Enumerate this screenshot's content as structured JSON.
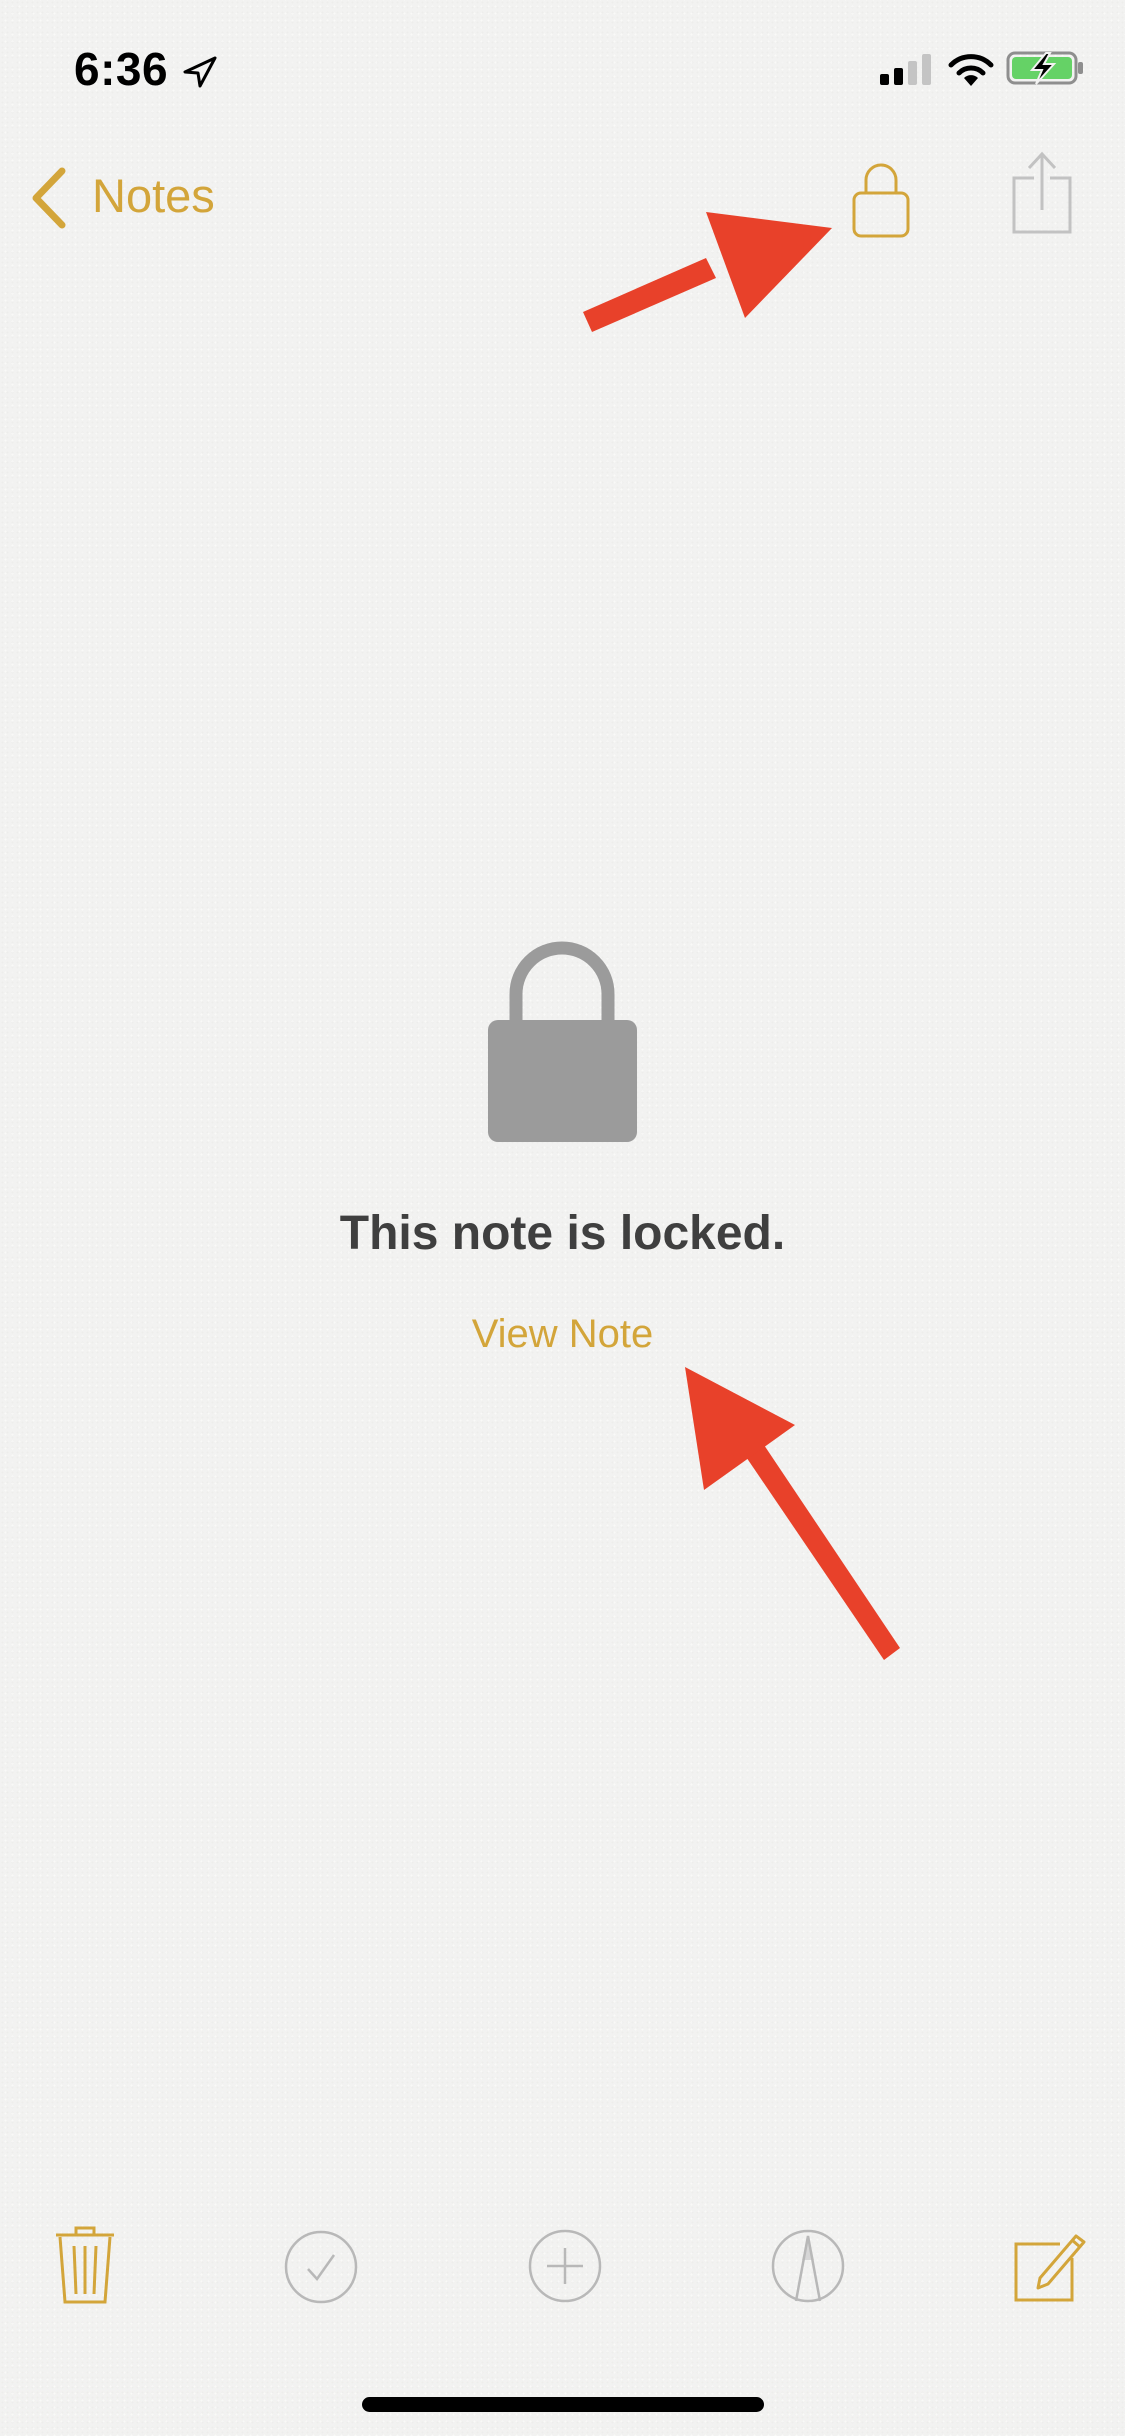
{
  "status_bar": {
    "time": "6:36",
    "location_icon": "location-arrow-icon",
    "signal_bars_active": 2,
    "signal_bars_total": 4,
    "wifi_icon": "wifi-icon",
    "battery_icon": "battery-charging-icon",
    "battery_level_fraction": 0.9,
    "charging": true
  },
  "nav_bar": {
    "back_label": "Notes",
    "back_icon": "chevron-left-icon",
    "lock_icon": "lock-icon",
    "share_icon": "share-icon"
  },
  "content": {
    "lock_icon": "lock-icon",
    "message": "This note is locked.",
    "view_note_label": "View Note"
  },
  "toolbar": {
    "items": [
      {
        "name": "delete",
        "icon": "trash-icon",
        "enabled": true
      },
      {
        "name": "checklist",
        "icon": "checkmark-circle-icon",
        "enabled": false
      },
      {
        "name": "add",
        "icon": "plus-circle-icon",
        "enabled": false
      },
      {
        "name": "sketch",
        "icon": "sketch-pen-icon",
        "enabled": false
      },
      {
        "name": "compose",
        "icon": "compose-icon",
        "enabled": true
      }
    ]
  },
  "annotations": [
    {
      "type": "arrow",
      "points_to": "lock-button",
      "color": "#e8412a"
    },
    {
      "type": "arrow",
      "points_to": "view-note-link",
      "color": "#e8412a"
    }
  ],
  "colors": {
    "accent": "#d3a53a",
    "disabled": "#b8b8b8",
    "text_dark": "#3f3f3f",
    "lock_grey": "#9b9b9b",
    "battery_green": "#65d266",
    "annotation_red": "#e8412a"
  }
}
